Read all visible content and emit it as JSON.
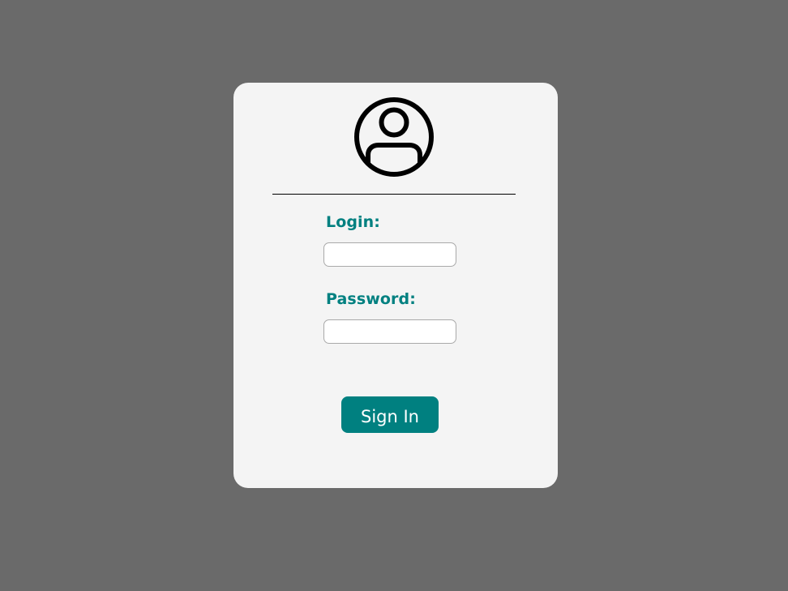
{
  "login_form": {
    "avatar_icon": "user-circle-icon",
    "login_label": "Login:",
    "login_value": "",
    "password_label": "Password:",
    "password_value": "",
    "signin_label": "Sign In"
  },
  "colors": {
    "page_background": "#6a6a6a",
    "card_background": "#f4f4f4",
    "accent": "#008080",
    "button_text": "#ffffff"
  }
}
